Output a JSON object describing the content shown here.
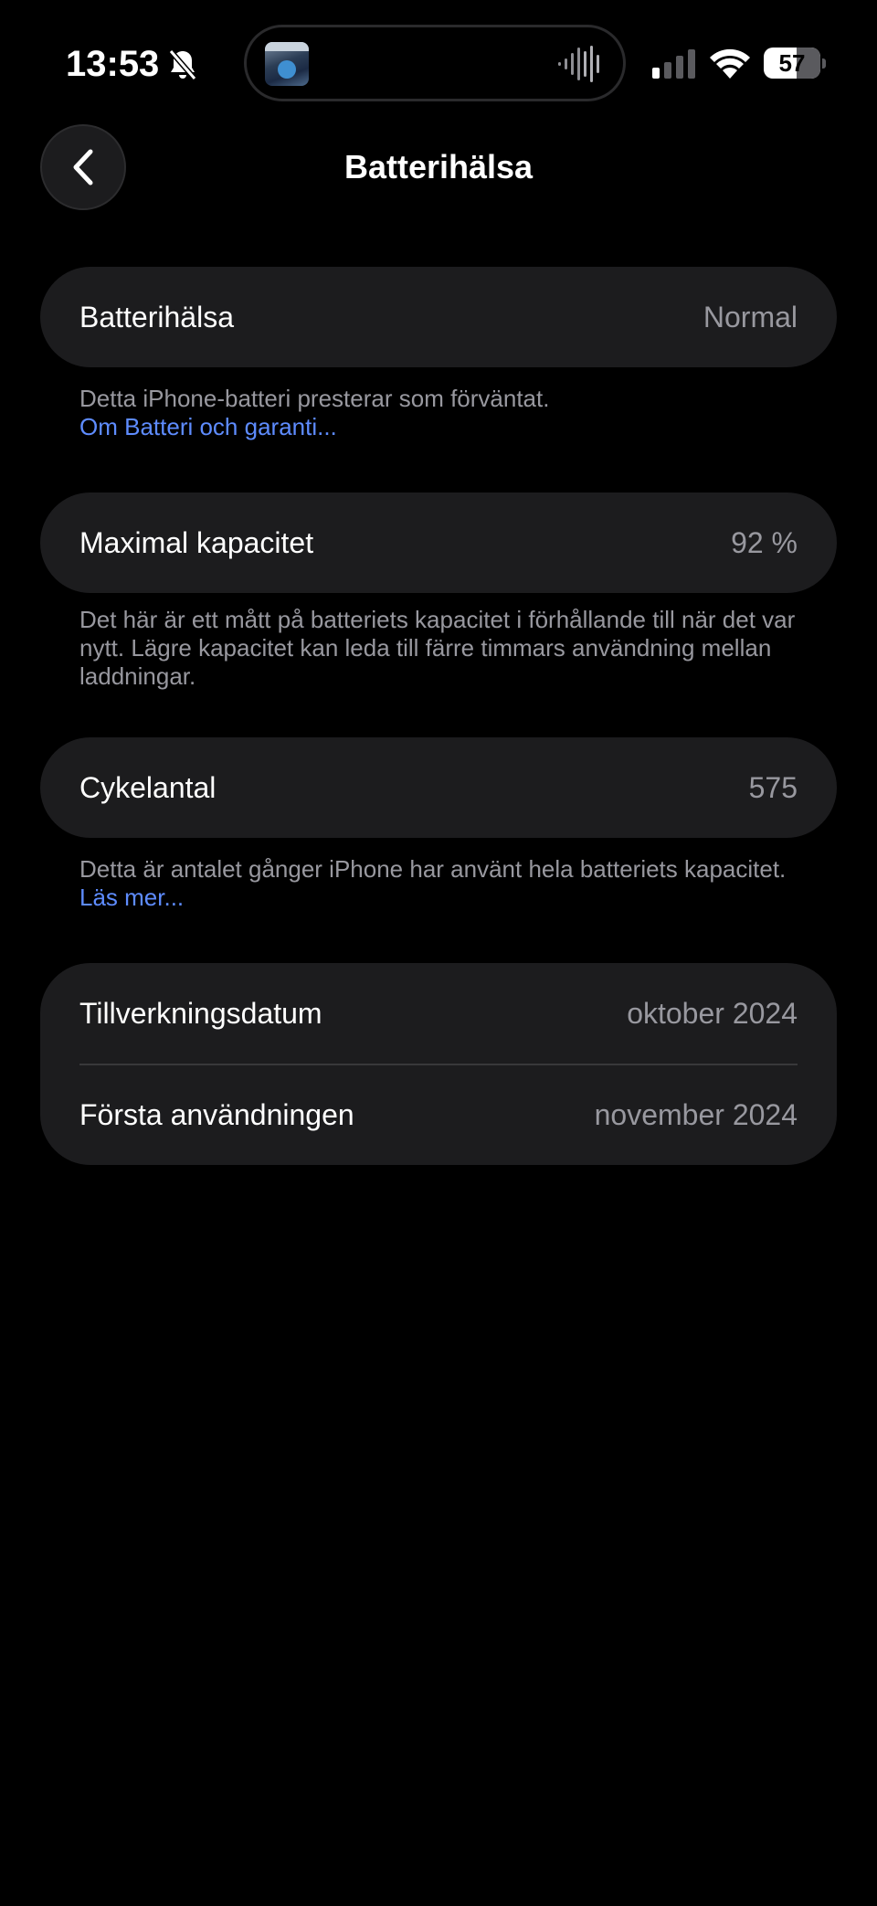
{
  "status_bar": {
    "time": "13:53",
    "battery_level": "57",
    "icons": [
      "bell-slash-icon",
      "album-art",
      "waveform-icon",
      "cellular-signal-icon",
      "wifi-icon",
      "battery-icon"
    ]
  },
  "nav": {
    "back_icon": "chevron-left-icon",
    "title": "Batterihälsa"
  },
  "battery_health": {
    "label": "Batterihälsa",
    "value": "Normal",
    "footnote": "Detta iPhone-batteri presterar som förväntat.",
    "link": "Om Batteri och garanti..."
  },
  "max_capacity": {
    "label": "Maximal kapacitet",
    "value": "92 %",
    "footnote": "Det här är ett mått på batteriets kapacitet i förhållande till när det var nytt. Lägre kapacitet kan leda till färre timmars användning mellan laddningar."
  },
  "cycle_count": {
    "label": "Cykelantal",
    "value": "575",
    "footnote": "Detta är antalet gånger iPhone har använt hela batteriets kapacitet.",
    "link": "Läs mer..."
  },
  "dates": {
    "manufacture_label": "Tillverkningsdatum",
    "manufacture_value": "oktober 2024",
    "first_use_label": "Första användningen",
    "first_use_value": "november 2024"
  },
  "colors": {
    "background": "#000000",
    "card": "#1c1c1e",
    "secondary_text": "#98989f",
    "link": "#5e8cff",
    "separator": "#38383a"
  }
}
